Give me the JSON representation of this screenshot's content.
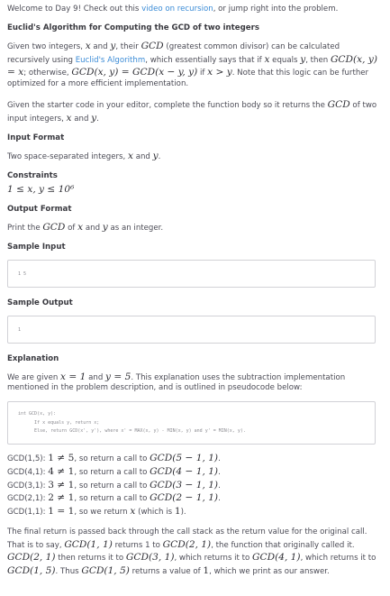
{
  "intro": {
    "before": "Welcome to Day 9! Check out this ",
    "link": "video on recursion",
    "after": ", or jump right into the problem."
  },
  "heading": "Euclid's Algorithm for Computing the GCD of two integers",
  "desc1": {
    "t1": "Given two integers, ",
    "x": "x",
    "t2": " and ",
    "y": "y",
    "t3": ", their ",
    "gcd": "GCD",
    "t4": " (greatest common divisor) can be calculated recursively using ",
    "link": "Euclid's Algorithm",
    "t5": ", which essentially says that if ",
    "t6": " equals ",
    "t7": ", then ",
    "eq1": "GCD(x, y) = x",
    "t8": "; otherwise, ",
    "eq2": "GCD(x, y) = GCD(x − y, y)",
    "t9": " if ",
    "eq3": "x > y",
    "t10": ". Note that this logic can be further optimized for a more efficient implementation."
  },
  "desc2": {
    "t1": "Given the starter code in your editor, complete the function body so it returns the ",
    "gcd": "GCD",
    "t2": " of two input integers, ",
    "x": "x",
    "t3": " and ",
    "y": "y",
    "t4": "."
  },
  "input_format": {
    "title": "Input Format",
    "t1": "Two space-separated integers, ",
    "x": "x",
    "t2": " and ",
    "y": "y",
    "t3": "."
  },
  "constraints": {
    "title": "Constraints",
    "expr": "1 ≤ x, y ≤ 10⁶"
  },
  "output_format": {
    "title": "Output Format",
    "t1": "Print the ",
    "gcd": "GCD",
    "t2": " of ",
    "x": "x",
    "t3": " and ",
    "y": "y",
    "t4": " as an integer."
  },
  "sample_input": {
    "title": "Sample Input",
    "value": "1 5"
  },
  "sample_output": {
    "title": "Sample Output",
    "value": "1"
  },
  "explanation": {
    "title": "Explanation",
    "t1": "We are given ",
    "eqx": "x = 1",
    "t2": " and ",
    "eqy": "y = 5",
    "t3": ". This explanation uses the subtraction implementation mentioned in the problem description, and is outlined in pseudocode below:",
    "code": [
      "int GCD(x, y):",
      "      If x equals y, return x;",
      "      Else, return GCD(x', y'), where x' = MAX(x, y) - MIN(x, y) and y' = MIN(x, y)."
    ],
    "steps": [
      {
        "label": "GCD(1,5): ",
        "cond": "1 ≠ 5",
        "mid": ", so return a call to ",
        "call": "GCD(5 − 1, 1)",
        "end": "."
      },
      {
        "label": "GCD(4,1): ",
        "cond": "4 ≠ 1",
        "mid": ", so return a call to ",
        "call": "GCD(4 − 1, 1)",
        "end": "."
      },
      {
        "label": "GCD(3,1): ",
        "cond": "3 ≠ 1",
        "mid": ", so return a call to ",
        "call": "GCD(3 − 1, 1)",
        "end": "."
      },
      {
        "label": "GCD(2,1): ",
        "cond": "2 ≠ 1",
        "mid": ", so return a call to ",
        "call": "GCD(2 − 1, 1)",
        "end": "."
      }
    ],
    "last": {
      "label": "GCD(1,1): ",
      "cond": "1 = 1",
      "mid": ", so we return ",
      "x": "x",
      "t": " (which is ",
      "one": "1",
      "end": ")."
    },
    "final": {
      "t1": "The final return is passed back through the call stack as the return value for the original call. That is to say, ",
      "a": "GCD(1, 1)",
      "t2": " returns 1 to ",
      "b": "GCD(2, 1)",
      "t3": ", the function that originally called it. ",
      "c": "GCD(2, 1)",
      "t4": " then returns it to ",
      "d": "GCD(3, 1)",
      "t5": ", which returns it to ",
      "e": "GCD(4, 1)",
      "t6": ", which returns it to ",
      "f": "GCD(1, 5)",
      "t7": ". Thus ",
      "g": "GCD(1, 5)",
      "t8": " returns a value of ",
      "h": "1",
      "t9": ", which we print as our answer."
    }
  }
}
